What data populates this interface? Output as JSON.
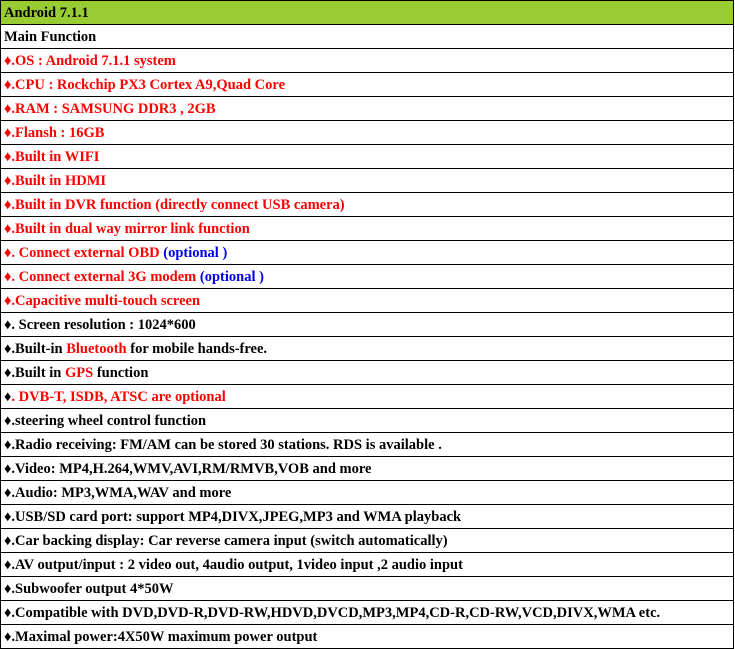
{
  "header": "Android 7.1.1",
  "section_title": "Main Function",
  "colors": {
    "header_bg": "#99cc33",
    "red": "#ff0000",
    "blue": "#0000ee",
    "black": "#000000"
  },
  "rows": [
    {
      "segments": [
        {
          "text": "♦.OS : Android 7.1.1 system",
          "color": "red"
        }
      ]
    },
    {
      "segments": [
        {
          "text": "♦.CPU : Rockchip PX3 Cortex A9,Quad Core",
          "color": "red"
        }
      ]
    },
    {
      "segments": [
        {
          "text": "♦.RAM : SAMSUNG DDR3 , 2GB",
          "color": "red"
        }
      ]
    },
    {
      "segments": [
        {
          "text": "♦.Flansh : 16GB",
          "color": "red"
        }
      ]
    },
    {
      "segments": [
        {
          "text": "♦.Built in WIFI",
          "color": "red"
        }
      ]
    },
    {
      "segments": [
        {
          "text": "♦.Built in HDMI",
          "color": "red"
        }
      ]
    },
    {
      "segments": [
        {
          "text": "♦.Built in DVR function (directly connect USB camera)",
          "color": "red"
        }
      ]
    },
    {
      "segments": [
        {
          "text": "♦.Built in dual way mirror link function",
          "color": "red"
        }
      ]
    },
    {
      "segments": [
        {
          "text": "♦. Connect external OBD  ",
          "color": "red"
        },
        {
          "text": "(optional )",
          "color": "blue"
        }
      ]
    },
    {
      "segments": [
        {
          "text": "♦. Connect external 3G modem ",
          "color": "red"
        },
        {
          "text": "(optional )",
          "color": "blue"
        }
      ]
    },
    {
      "segments": [
        {
          "text": "♦.Capacitive multi-touch screen",
          "color": "red"
        }
      ]
    },
    {
      "segments": [
        {
          "text": "♦. Screen resolution  : 1024*600",
          "color": "black"
        }
      ]
    },
    {
      "segments": [
        {
          "text": "♦.Built-in ",
          "color": "black"
        },
        {
          "text": "Bluetooth",
          "color": "red"
        },
        {
          "text": " for mobile hands-free.",
          "color": "black"
        }
      ]
    },
    {
      "segments": [
        {
          "text": "♦.Built in ",
          "color": "black"
        },
        {
          "text": "GPS",
          "color": "red"
        },
        {
          "text": " function",
          "color": "black"
        }
      ]
    },
    {
      "segments": [
        {
          "text": "♦",
          "color": "black"
        },
        {
          "text": ". DVB-T, ISDB, ATSC are optional",
          "color": "red"
        }
      ]
    },
    {
      "segments": [
        {
          "text": "♦.steering wheel control function",
          "color": "black"
        }
      ]
    },
    {
      "segments": [
        {
          "text": "♦.Radio receiving: FM/AM can be stored 30 stations. RDS is available .",
          "color": "black"
        }
      ]
    },
    {
      "segments": [
        {
          "text": "♦.Video: MP4,H.264,WMV,AVI,RM/RMVB,VOB and more",
          "color": "black"
        }
      ]
    },
    {
      "segments": [
        {
          "text": "♦.Audio: MP3,WMA,WAV and more",
          "color": "black"
        }
      ]
    },
    {
      "segments": [
        {
          "text": "♦.USB/SD card port: support MP4,DIVX,JPEG,MP3 and WMA playback",
          "color": "black"
        }
      ]
    },
    {
      "segments": [
        {
          "text": "♦.Car backing display: Car reverse camera input (switch automatically)",
          "color": "black"
        }
      ]
    },
    {
      "segments": [
        {
          "text": "♦.AV output/input : 2 video out, 4audio output, 1video input ,2 audio input",
          "color": "black"
        }
      ]
    },
    {
      "segments": [
        {
          "text": "♦.Subwoofer output 4*50W",
          "color": "black"
        }
      ]
    },
    {
      "segments": [
        {
          "text": "♦.Compatible with DVD,DVD-R,DVD-RW,HDVD,DVCD,MP3,MP4,CD-R,CD-RW,VCD,DIVX,WMA etc.",
          "color": "black"
        }
      ]
    },
    {
      "segments": [
        {
          "text": "♦.Maximal power:4X50W maximum power output",
          "color": "black"
        }
      ]
    }
  ]
}
